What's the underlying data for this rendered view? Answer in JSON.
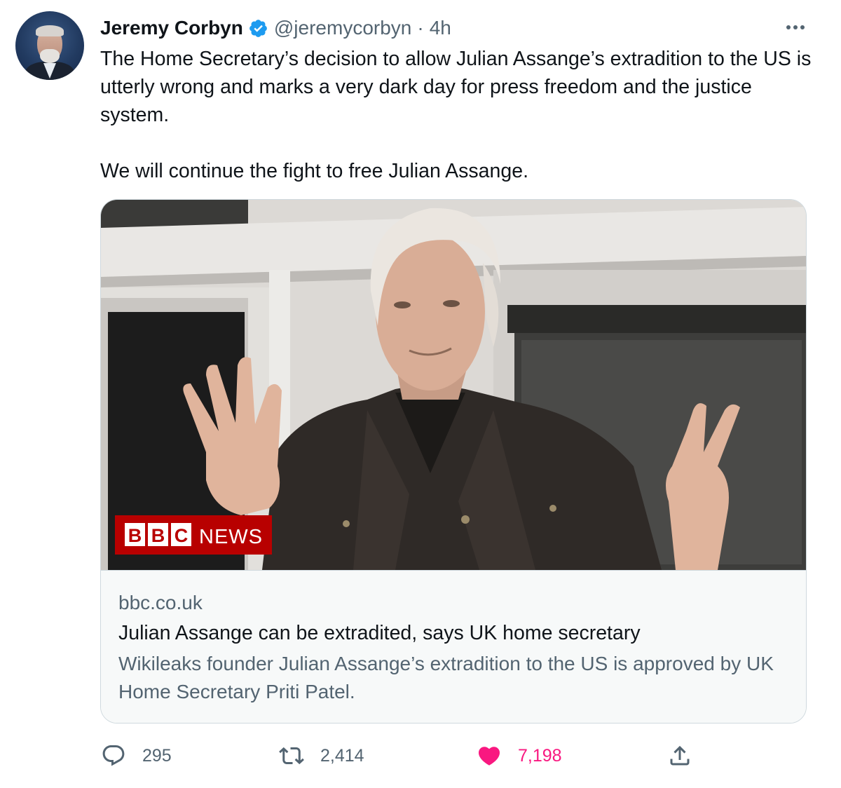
{
  "author": {
    "display_name": "Jeremy Corbyn",
    "handle": "@jeremycorbyn",
    "separator": "·",
    "time": "4h",
    "verified": true,
    "verified_color": "#1d9bf0"
  },
  "tweet": {
    "paragraphs": [
      "The Home Secretary’s decision to allow Julian Assange’s extradition to the US is utterly wrong and marks a very dark day for press freedom and the justice system.",
      "We will continue the fight to free Julian Assange."
    ]
  },
  "card": {
    "image_logo_text": "BBC NEWS",
    "domain": "bbc.co.uk",
    "title": "Julian Assange can be extradited, says UK home secretary",
    "description": "Wikileaks founder Julian Assange’s extradition to the US is approved by UK Home Secretary Priti Patel."
  },
  "actions": {
    "reply_count": "295",
    "retweet_count": "2,414",
    "like_count": "7,198",
    "liked": true,
    "like_color": "#f91880",
    "icons": [
      "reply-icon",
      "retweet-icon",
      "heart-icon",
      "share-icon"
    ]
  }
}
